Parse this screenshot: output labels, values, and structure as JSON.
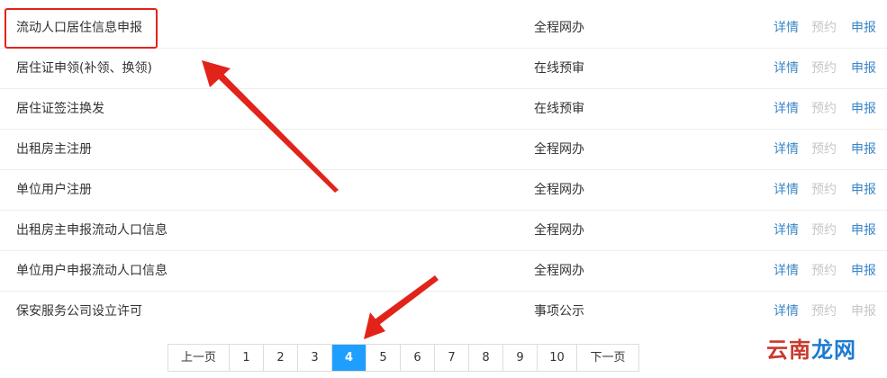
{
  "services": [
    {
      "name": "流动人口居住信息申报",
      "mode": "全程网办",
      "detail": "详情",
      "book": "预约",
      "apply": "申报",
      "apply_enabled": true
    },
    {
      "name": "居住证申领(补领、换领)",
      "mode": "在线预审",
      "detail": "详情",
      "book": "预约",
      "apply": "申报",
      "apply_enabled": true
    },
    {
      "name": "居住证签注换发",
      "mode": "在线预审",
      "detail": "详情",
      "book": "预约",
      "apply": "申报",
      "apply_enabled": true
    },
    {
      "name": "出租房主注册",
      "mode": "全程网办",
      "detail": "详情",
      "book": "预约",
      "apply": "申报",
      "apply_enabled": true
    },
    {
      "name": "单位用户注册",
      "mode": "全程网办",
      "detail": "详情",
      "book": "预约",
      "apply": "申报",
      "apply_enabled": true
    },
    {
      "name": "出租房主申报流动人口信息",
      "mode": "全程网办",
      "detail": "详情",
      "book": "预约",
      "apply": "申报",
      "apply_enabled": true
    },
    {
      "name": "单位用户申报流动人口信息",
      "mode": "全程网办",
      "detail": "详情",
      "book": "预约",
      "apply": "申报",
      "apply_enabled": true
    },
    {
      "name": "保安服务公司设立许可",
      "mode": "事项公示",
      "detail": "详情",
      "book": "预约",
      "apply": "申报",
      "apply_enabled": false
    }
  ],
  "pagination": {
    "prev": "上一页",
    "next": "下一页",
    "pages": [
      "1",
      "2",
      "3",
      "4",
      "5",
      "6",
      "7",
      "8",
      "9",
      "10"
    ],
    "current": "4"
  },
  "watermark": {
    "part1": "云南",
    "part2": "龙网"
  },
  "colors": {
    "link": "#3a86c8",
    "disabled": "#c6c6c6",
    "current_page": "#1e9fff",
    "annotation": "#e2231a"
  }
}
